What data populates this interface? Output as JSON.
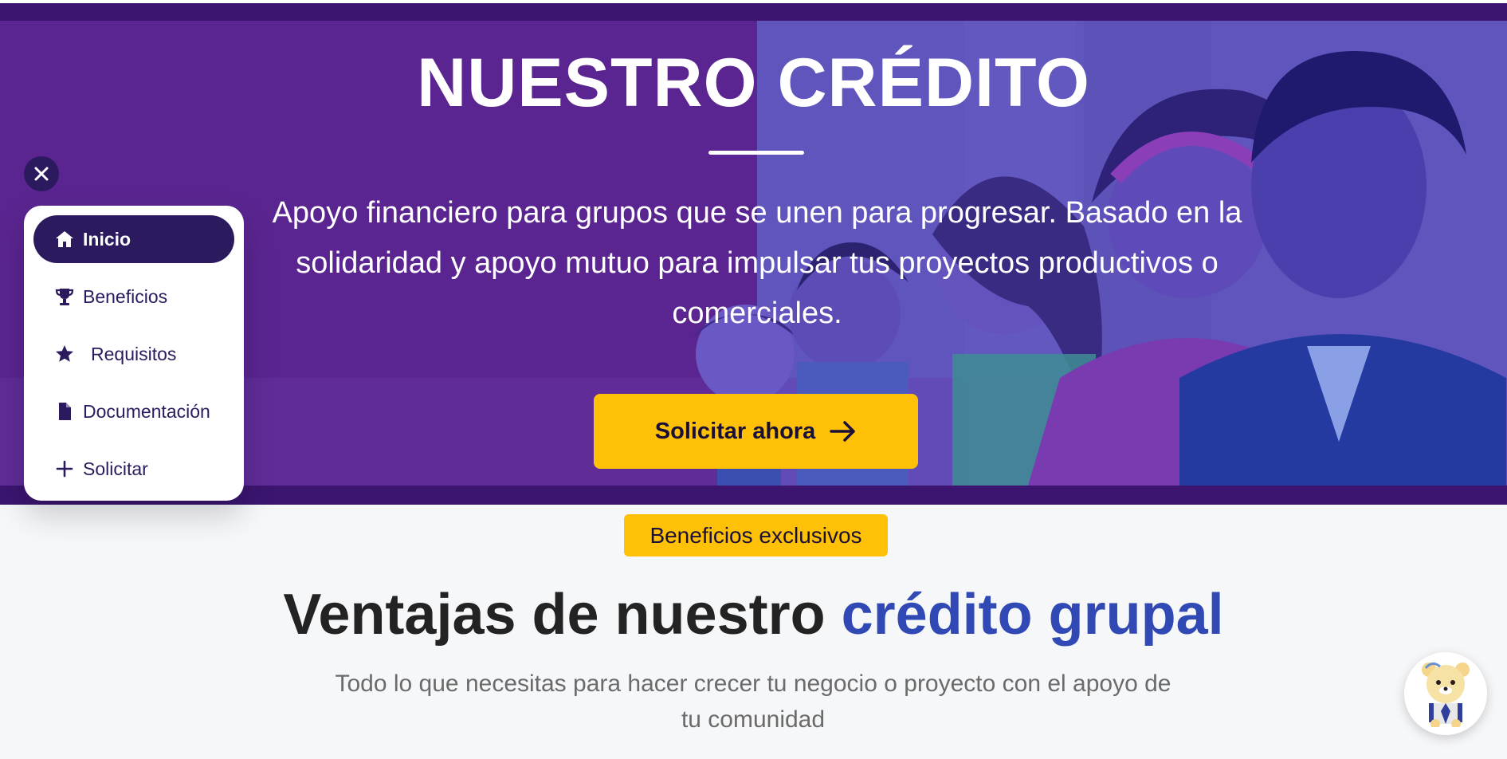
{
  "hero": {
    "title": "NUESTRO CRÉDITO",
    "subtitle": "Apoyo financiero para grupos que se unen para progresar. Basado en la solidaridad y apoyo mutuo para impulsar tus proyectos productivos o comerciales.",
    "cta_label": "Solicitar ahora",
    "cta_icon": "arrow-right-icon"
  },
  "nav": {
    "close_icon": "close-icon",
    "items": [
      {
        "label": "Inicio",
        "icon": "home-icon",
        "active": true
      },
      {
        "label": "Beneficios",
        "icon": "trophy-icon",
        "active": false
      },
      {
        "label": "Requisitos",
        "icon": "star-icon",
        "active": false
      },
      {
        "label": "Documentación",
        "icon": "file-icon",
        "active": false
      },
      {
        "label": "Solicitar",
        "icon": "plus-icon",
        "active": false
      }
    ]
  },
  "benefits": {
    "badge": "Beneficios exclusivos",
    "title_main": "Ventajas de nuestro ",
    "title_accent": "crédito grupal",
    "subtitle": "Todo lo que necesitas para hacer crecer tu negocio o proyecto con el apoyo de tu comunidad"
  },
  "chat": {
    "avatar_icon": "bear-mascot-icon"
  },
  "colors": {
    "hero_bg": "#5a2590",
    "hero_band": "#3b1570",
    "nav_dark": "#2b1b5e",
    "accent_yellow": "#ffc107",
    "accent_blue": "#3049b4"
  }
}
